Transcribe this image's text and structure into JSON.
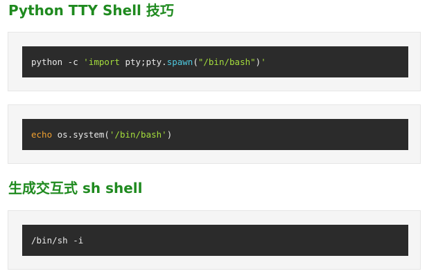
{
  "headings": {
    "python_tty": "Python TTY Shell 技巧",
    "sh_shell": "生成交互式 sh shell"
  },
  "code_blocks": {
    "block1": {
      "cmd": "python -c ",
      "str_open": "'import",
      "mid": " pty;pty.",
      "fn": "spawn",
      "paren_open": "(",
      "path": "\"/bin/bash\"",
      "paren_close": ")",
      "str_close": "'"
    },
    "block2": {
      "kw": "echo",
      "rest": " os.system(",
      "path": "'/bin/bash'",
      "close": ")"
    },
    "block3": {
      "cmd": "/bin/sh -i"
    }
  },
  "colors": {
    "heading": "#1f8a1f",
    "code_bg": "#2b2b2b",
    "string": "#a5de3c",
    "function": "#4ec9e0",
    "keyword": "#f0a030"
  }
}
